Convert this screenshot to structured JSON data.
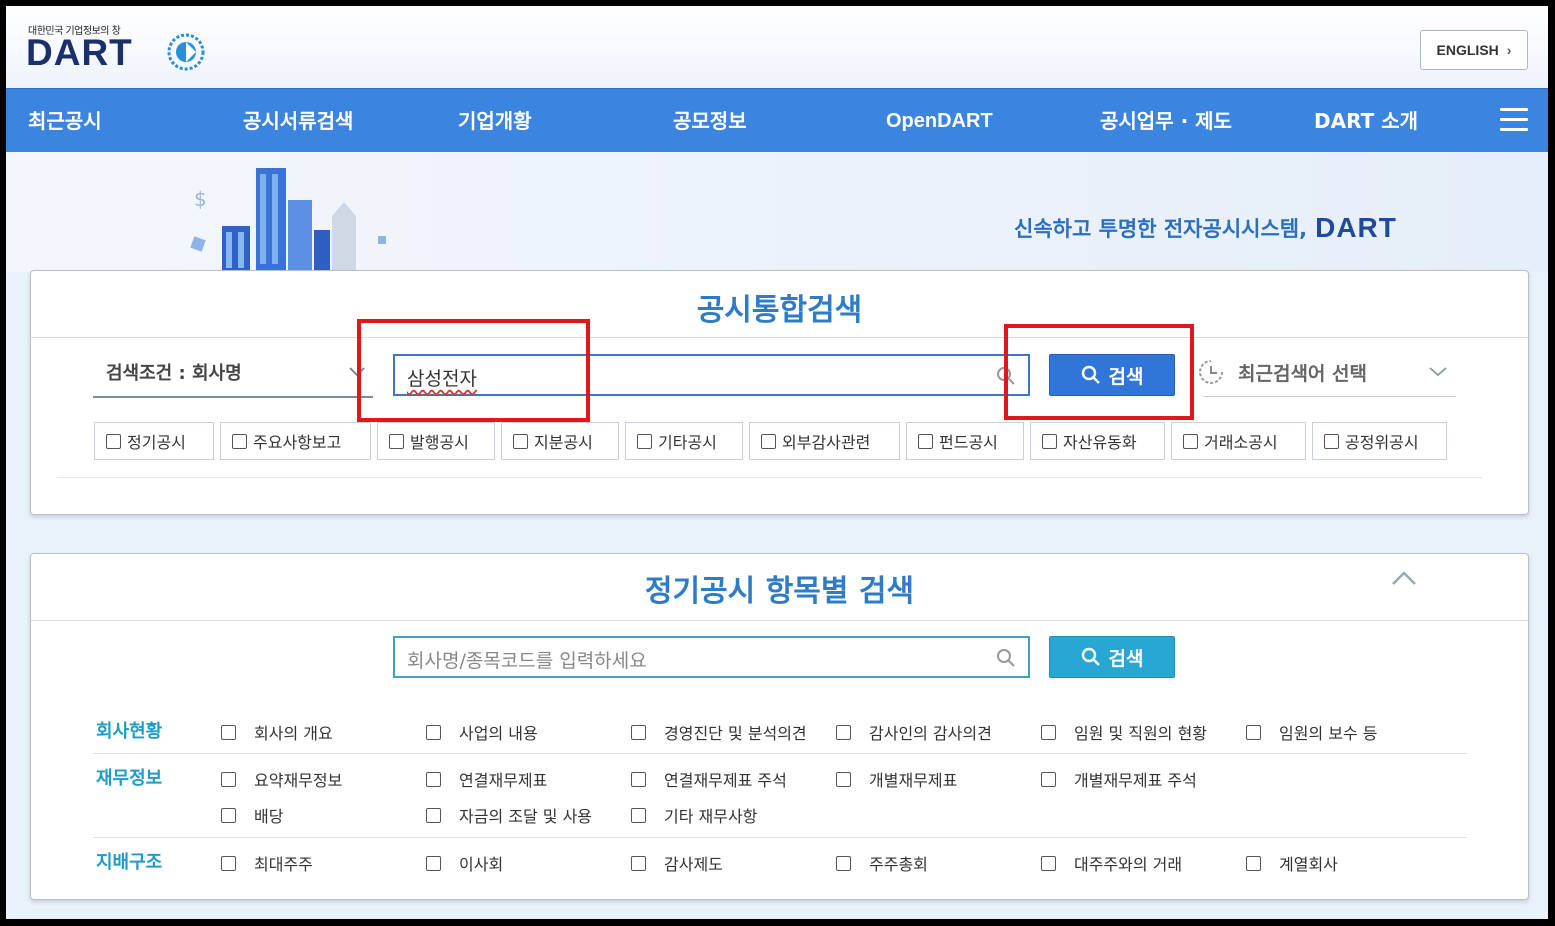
{
  "header": {
    "logo_sub": "대한민국 기업정보의 창",
    "logo_main": "DART",
    "english_label": "ENGLISH"
  },
  "nav": {
    "items": [
      "최근공시",
      "공시서류검색",
      "기업개황",
      "공모정보",
      "OpenDART",
      "공시업무 · 제도",
      "DART 소개"
    ]
  },
  "banner": {
    "tagline": "신속하고 투명한 전자공시시스템,",
    "brand": "DART"
  },
  "integrated_search": {
    "title": "공시통합검색",
    "condition": "검색조건 : 회사명",
    "query": "삼성전자",
    "search_label": "검색",
    "recent_label": "최근검색어 선택",
    "filters": [
      "정기공시",
      "주요사항보고",
      "발행공시",
      "지분공시",
      "기타공시",
      "외부감사관련",
      "펀드공시",
      "자산유동화",
      "거래소공시",
      "공정위공시"
    ]
  },
  "item_search": {
    "title": "정기공시 항목별 검색",
    "placeholder": "회사명/종목코드를 입력하세요",
    "search_label": "검색",
    "categories": [
      {
        "label": "회사현황",
        "options": [
          "회사의 개요",
          "사업의 내용",
          "경영진단 및 분석의견",
          "감사인의 감사의견",
          "임원 및 직원의 현황",
          "임원의 보수 등"
        ]
      },
      {
        "label": "재무정보",
        "options": [
          "요약재무정보",
          "연결재무제표",
          "연결재무제표 주석",
          "개별재무제표",
          "개별재무제표 주석",
          "배당",
          "자금의 조달 및 사용",
          "기타 재무사항"
        ]
      },
      {
        "label": "지배구조",
        "options": [
          "최대주주",
          "이사회",
          "감사제도",
          "주주총회",
          "대주주와의 거래",
          "계열회사"
        ]
      }
    ]
  },
  "colors": {
    "nav": "#3b84e0",
    "search_button": "#2f76d8",
    "item_button": "#28a6d4",
    "highlight": "#e0181b"
  },
  "icons": [
    "search-icon",
    "clock-icon",
    "chevron-down-icon",
    "chevron-up-icon",
    "menu-icon",
    "chevron-right-icon"
  ]
}
